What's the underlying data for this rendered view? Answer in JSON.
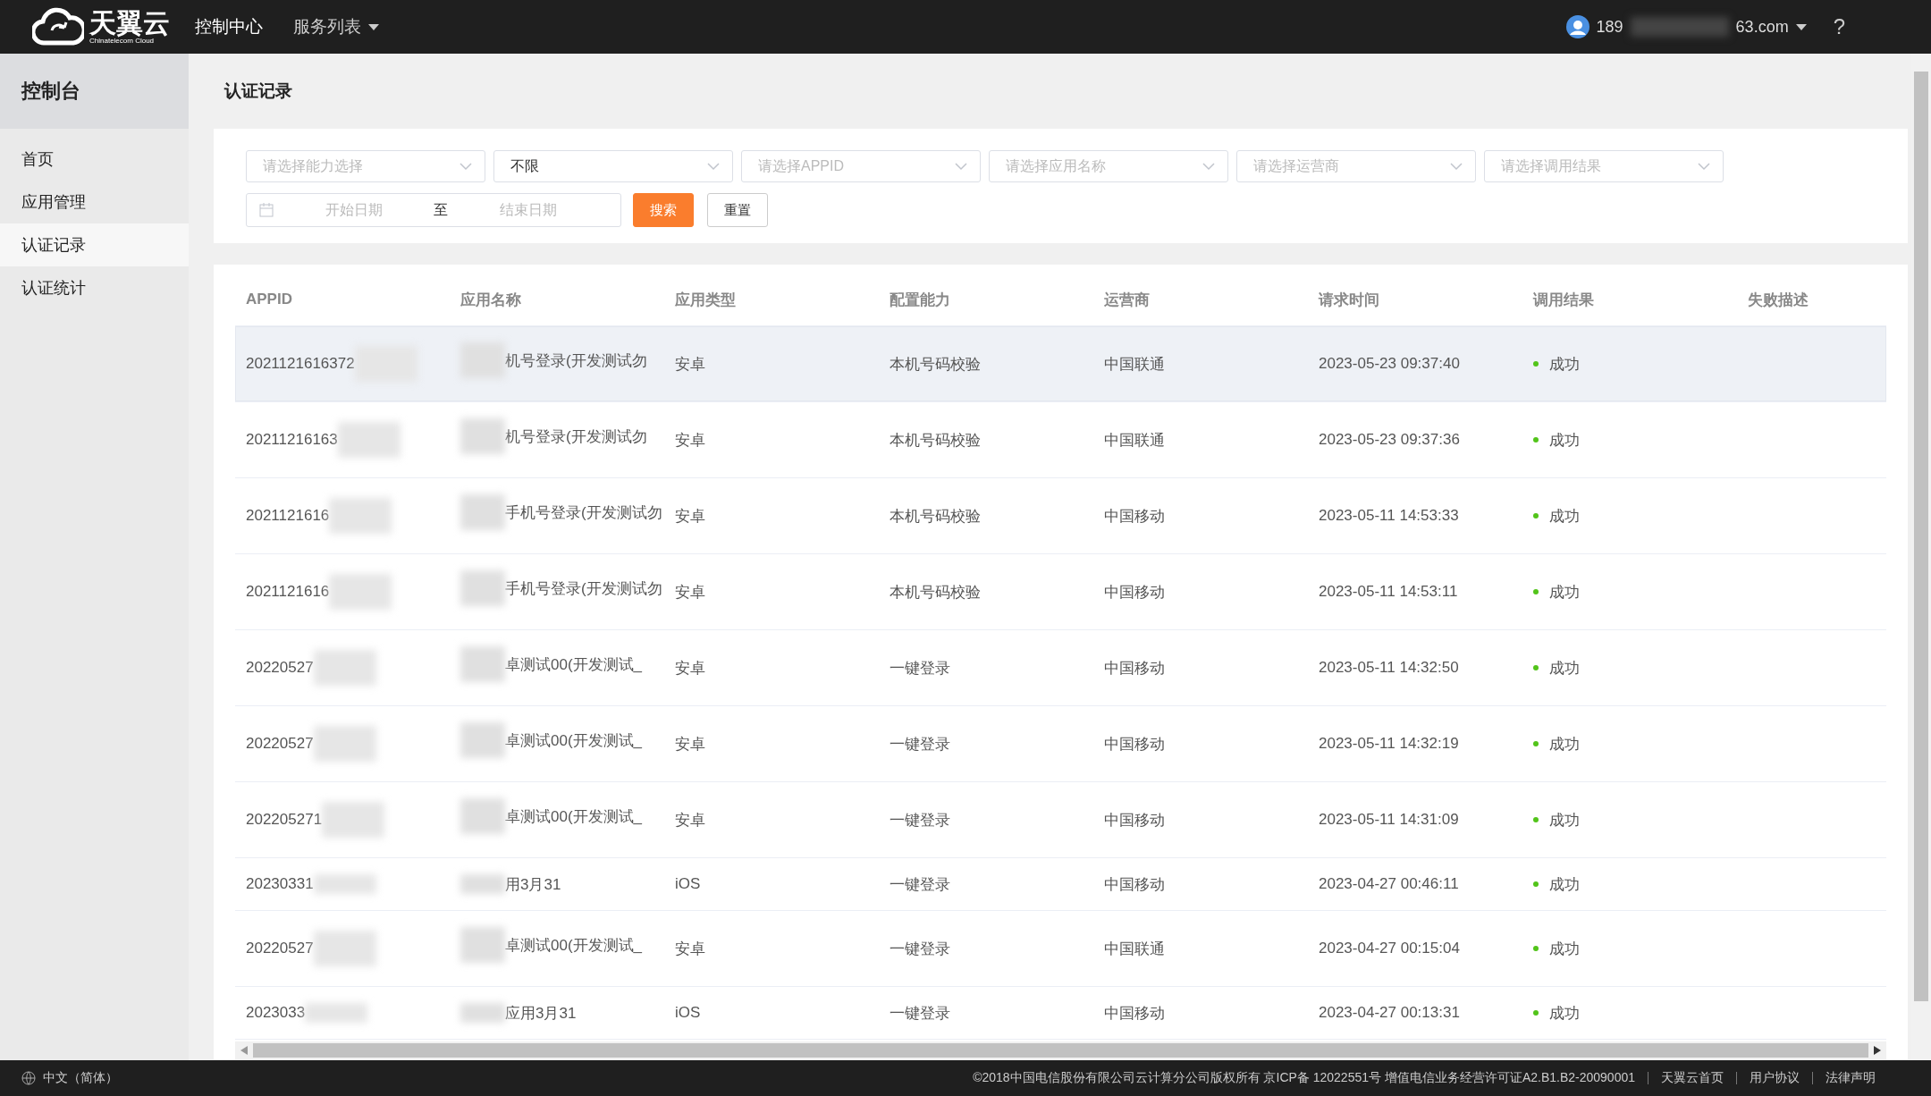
{
  "header": {
    "logo": {
      "name": "天翼云",
      "sub": "Chinatelecom Cloud"
    },
    "nav": [
      {
        "label": "控制中心",
        "dropdown": false
      },
      {
        "label": "服务列表",
        "dropdown": true
      }
    ],
    "account": {
      "email_start": "189",
      "email_end": "63.com"
    },
    "help": "?"
  },
  "sidebar": {
    "title": "控制台",
    "items": [
      {
        "label": "首页",
        "selected": false
      },
      {
        "label": "应用管理",
        "selected": false
      },
      {
        "label": "认证记录",
        "selected": true
      },
      {
        "label": "认证统计",
        "selected": false
      }
    ]
  },
  "page_title": "认证记录",
  "filters": {
    "selects": [
      {
        "placeholder": "请选择能力选择"
      },
      {
        "value": "不限"
      },
      {
        "placeholder": "请选择APPID"
      },
      {
        "placeholder": "请选择应用名称"
      },
      {
        "placeholder": "请选择运营商"
      },
      {
        "placeholder": "请选择调用结果"
      }
    ],
    "date_range": {
      "start_placeholder": "开始日期",
      "separator": "至",
      "end_placeholder": "结束日期"
    },
    "buttons": [
      {
        "label": "搜索",
        "kind": "primary"
      },
      {
        "label": "重置",
        "kind": "default"
      }
    ]
  },
  "table": {
    "columns": [
      "APPID",
      "应用名称",
      "应用类型",
      "配置能力",
      "运营商",
      "请求时间",
      "调用结果",
      "失败描述"
    ],
    "rows": [
      {
        "appid": "2021121616372",
        "name": "机号登录(开发测试勿",
        "type": "安卓",
        "capability": "本机号码校验",
        "carrier": "中国联通",
        "time": "2023-05-23 09:37:40",
        "result": "成功",
        "selected": true,
        "tall": true
      },
      {
        "appid": "20211216163",
        "name": "机号登录(开发测试勿",
        "type": "安卓",
        "capability": "本机号码校验",
        "carrier": "中国联通",
        "time": "2023-05-23 09:37:36",
        "result": "成功",
        "selected": false,
        "tall": true
      },
      {
        "appid": "2021121616",
        "name": "手机号登录(开发测试勿",
        "type": "安卓",
        "capability": "本机号码校验",
        "carrier": "中国移动",
        "time": "2023-05-11 14:53:33",
        "result": "成功",
        "selected": false,
        "tall": true
      },
      {
        "appid": "2021121616",
        "name": "手机号登录(开发测试勿",
        "type": "安卓",
        "capability": "本机号码校验",
        "carrier": "中国移动",
        "time": "2023-05-11 14:53:11",
        "result": "成功",
        "selected": false,
        "tall": true
      },
      {
        "appid": "20220527",
        "name": "卓测试00(开发测试_",
        "type": "安卓",
        "capability": "一键登录",
        "carrier": "中国移动",
        "time": "2023-05-11 14:32:50",
        "result": "成功",
        "selected": false,
        "tall": true
      },
      {
        "appid": "20220527",
        "name": "卓测试00(开发测试_",
        "type": "安卓",
        "capability": "一键登录",
        "carrier": "中国移动",
        "time": "2023-05-11 14:32:19",
        "result": "成功",
        "selected": false,
        "tall": true
      },
      {
        "appid": "202205271",
        "name": "卓测试00(开发测试_",
        "type": "安卓",
        "capability": "一键登录",
        "carrier": "中国移动",
        "time": "2023-05-11 14:31:09",
        "result": "成功",
        "selected": false,
        "tall": true
      },
      {
        "appid": "20230331",
        "name": "用3月31",
        "type": "iOS",
        "capability": "一键登录",
        "carrier": "中国移动",
        "time": "2023-04-27 00:46:11",
        "result": "成功",
        "selected": false,
        "tall": false
      },
      {
        "appid": "20220527",
        "name": "卓测试00(开发测试_",
        "type": "安卓",
        "capability": "一键登录",
        "carrier": "中国联通",
        "time": "2023-04-27 00:15:04",
        "result": "成功",
        "selected": false,
        "tall": true
      },
      {
        "appid": "2023033",
        "name": "应用3月31",
        "type": "iOS",
        "capability": "一键登录",
        "carrier": "中国移动",
        "time": "2023-04-27 00:13:31",
        "result": "成功",
        "selected": false,
        "tall": false
      }
    ]
  },
  "footer": {
    "language": "中文（简体）",
    "copyright": "©2018中国电信股份有限公司云计算分公司版权所有 京ICP备 12022551号 增值电信业务经营许可证A2.B1.B2-20090001",
    "links": [
      "天翼云首页",
      "用户协议",
      "法律声明"
    ]
  }
}
